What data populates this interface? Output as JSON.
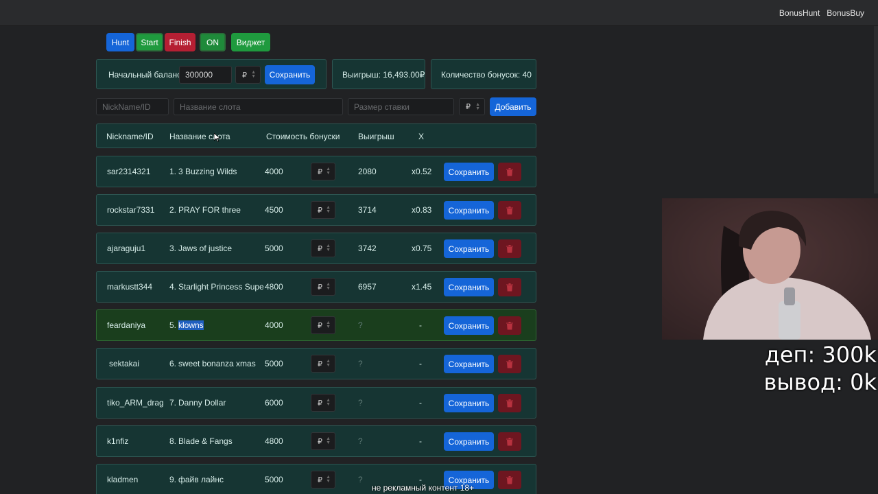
{
  "topnav": {
    "items": [
      "BonusHunt",
      "BonusBuy"
    ]
  },
  "modes": [
    {
      "label": "Hunt",
      "color": "#1565d8"
    },
    {
      "label": "Start",
      "color": "#1f9a3e"
    },
    {
      "label": "Finish",
      "color": "#b51f33"
    }
  ],
  "toggle_label": "ON",
  "widget_label": "Виджет",
  "balance": {
    "label": "Начальный баланс:",
    "value": "300000",
    "currency": "₽",
    "save_label": "Сохранить"
  },
  "winnings_label": "Выигрыш: 16,493.00₽",
  "bonus_count_label": "Количество бонусок: 40",
  "add_form": {
    "nickname_placeholder": "NickName/ID",
    "slot_placeholder": "Название слота",
    "bet_placeholder": "Размер ставки",
    "currency": "₽",
    "add_label": "Добавить"
  },
  "table": {
    "headers": [
      "Nickname/ID",
      "Название слота",
      "Стоимость бонуски",
      "Выигрыш",
      "X"
    ],
    "rows": [
      {
        "nickname": "sar2314321",
        "slot_num": "1.",
        "slot": "3 Buzzing Wilds",
        "cost": "4000",
        "currency": "₽",
        "win": "2080",
        "x": "x0.52",
        "save": "Сохранить"
      },
      {
        "nickname": "rockstar7331",
        "slot_num": "2.",
        "slot": "PRAY FOR three",
        "cost": "4500",
        "currency": "₽",
        "win": "3714",
        "x": "x0.83",
        "save": "Сохранить"
      },
      {
        "nickname": "ajaraguju1",
        "slot_num": "3.",
        "slot": "Jaws of justice",
        "cost": "5000",
        "currency": "₽",
        "win": "3742",
        "x": "x0.75",
        "save": "Сохранить"
      },
      {
        "nickname": "markustt344",
        "slot_num": "4.",
        "slot": "Starlight Princess Supe",
        "cost": "4800",
        "currency": "₽",
        "win": "6957",
        "x": "x1.45",
        "save": "Сохранить"
      },
      {
        "nickname": "feardaniya",
        "slot_num": "5.",
        "slot": "klowns",
        "cost": "4000",
        "currency": "₽",
        "win": "?",
        "x": "-",
        "save": "Сохранить",
        "active": true
      },
      {
        "nickname": "sektakai",
        "slot_num": "6.",
        "slot": "sweet bonanza xmas",
        "cost": "5000",
        "currency": "₽",
        "win": "?",
        "x": "-",
        "save": "Сохранить"
      },
      {
        "nickname": "tiko_ARM_drag",
        "slot_num": "7.",
        "slot": "Danny Dollar",
        "cost": "6000",
        "currency": "₽",
        "win": "?",
        "x": "-",
        "save": "Сохранить"
      },
      {
        "nickname": "k1nfiz",
        "slot_num": "8.",
        "slot": "Blade & Fangs",
        "cost": "4800",
        "currency": "₽",
        "win": "?",
        "x": "-",
        "save": "Сохранить"
      },
      {
        "nickname": "kladmen",
        "slot_num": "9.",
        "slot": "файв лайнс",
        "cost": "5000",
        "currency": "₽",
        "win": "?",
        "x": "-",
        "save": "Сохранить"
      }
    ]
  },
  "overlay": {
    "dep": "деп: 300k",
    "withdraw": "вывод: 0k",
    "subtitle": "не рекламный контент 18+"
  }
}
